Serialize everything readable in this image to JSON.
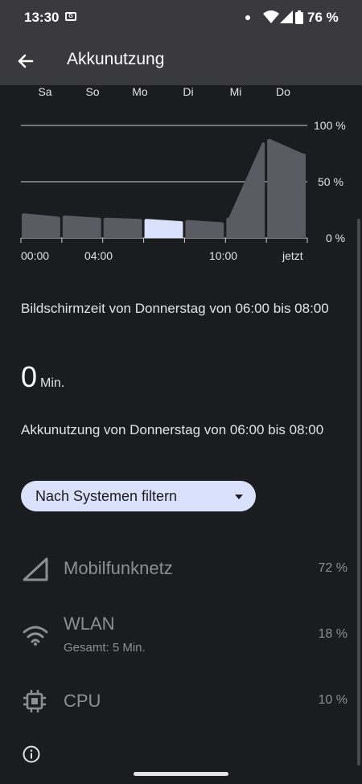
{
  "status": {
    "time": "13:30",
    "battery": "76 %"
  },
  "appbar": {
    "title": "Akkunutzung"
  },
  "chart_data": {
    "type": "bar",
    "days": [
      "Sa",
      "So",
      "Mo",
      "Di",
      "Mi",
      "Do"
    ],
    "y_tick_labels": [
      "100 %",
      "50 %",
      "0 %"
    ],
    "x_tick_labels": [
      "00:00",
      "04:00",
      "10:00",
      "jetzt"
    ],
    "ylim": [
      0,
      100
    ],
    "categories": [
      "00:00-02:00",
      "02:00-04:00",
      "04:00-06:00",
      "06:00-08:00",
      "08:00-10:00",
      "10:00-12:00",
      "12:00-13:30"
    ],
    "series": [
      {
        "values_start": [
          22,
          20,
          18,
          17,
          16,
          18,
          88
        ],
        "values_end": [
          19,
          18,
          17,
          15,
          14,
          85,
          75
        ]
      }
    ],
    "selected_index": 3,
    "grid": true
  },
  "screen_time": {
    "title": "Bildschirmzeit von Donnerstag von 06:00 bis 08:00",
    "value": "0",
    "unit": "Min."
  },
  "battery_usage": {
    "title": "Akkunutzung von Donnerstag von 06:00 bis 08:00"
  },
  "filter": {
    "label": "Nach Systemen filtern"
  },
  "items": [
    {
      "label": "Mobilfunknetz",
      "sub": "",
      "percent": "72 %",
      "icon": "cell-signal-icon"
    },
    {
      "label": "WLAN",
      "sub": "Gesamt: 5 Min.",
      "percent": "18 %",
      "icon": "wifi-icon"
    },
    {
      "label": "CPU",
      "sub": "",
      "percent": "10 %",
      "icon": "cpu-icon"
    }
  ],
  "colors": {
    "background": "#1b1c20",
    "appbar": "#3a3a3c",
    "bar": "#5b5c63",
    "bar_selected": "#d9e1fb",
    "filter_chip": "#d9e1fb"
  }
}
